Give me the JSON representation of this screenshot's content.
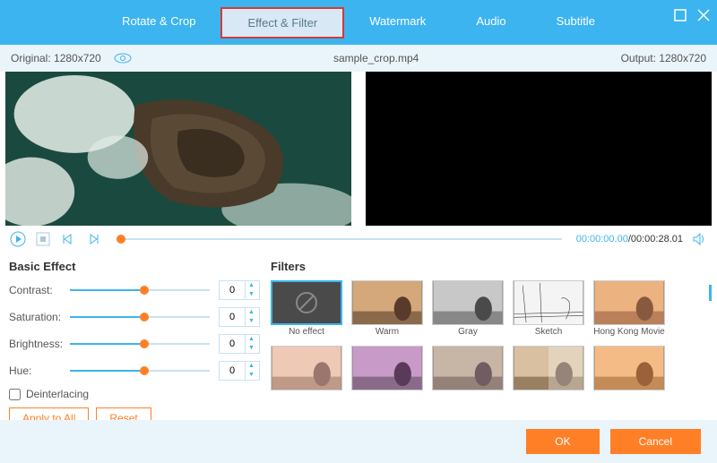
{
  "tabs": {
    "rotate": "Rotate & Crop",
    "effect": "Effect & Filter",
    "watermark": "Watermark",
    "audio": "Audio",
    "subtitle": "Subtitle"
  },
  "info": {
    "original": "Original: 1280x720",
    "filename": "sample_crop.mp4",
    "output": "Output: 1280x720"
  },
  "playback": {
    "current": "00:00:00.00",
    "total": "/00:00:28.01"
  },
  "basic": {
    "title": "Basic Effect",
    "contrast_label": "Contrast:",
    "saturation_label": "Saturation:",
    "brightness_label": "Brightness:",
    "hue_label": "Hue:",
    "contrast_value": "0",
    "saturation_value": "0",
    "brightness_value": "0",
    "hue_value": "0",
    "deinterlacing": "Deinterlacing",
    "apply_all": "Apply to All",
    "reset": "Reset"
  },
  "filters": {
    "title": "Filters",
    "items": [
      "No effect",
      "Warm",
      "Gray",
      "Sketch",
      "Hong Kong Movie"
    ]
  },
  "footer": {
    "ok": "OK",
    "cancel": "Cancel"
  }
}
